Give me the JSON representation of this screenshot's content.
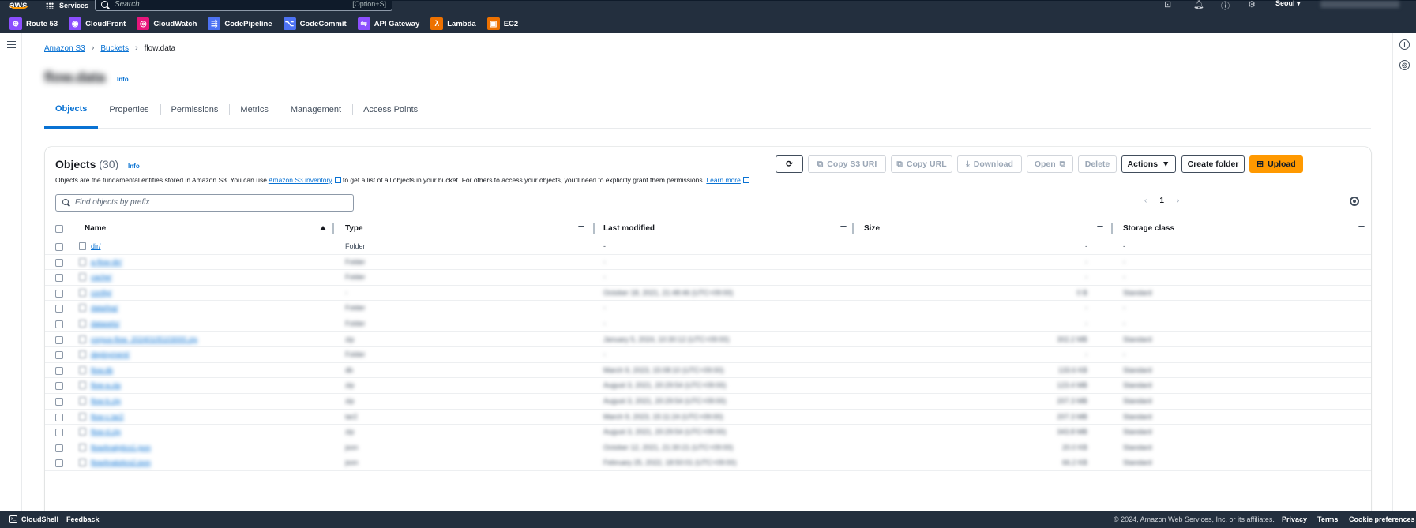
{
  "topnav": {
    "services_label": "Services",
    "search_placeholder": "Search",
    "search_shortcut": "[Option+S]",
    "region": "Seoul",
    "favorites": [
      {
        "label": "Route 53",
        "color": "#8c4fff",
        "icon": "route53-icon"
      },
      {
        "label": "CloudFront",
        "color": "#8c4fff",
        "icon": "cloudfront-icon"
      },
      {
        "label": "CloudWatch",
        "color": "#e7157b",
        "icon": "cloudwatch-icon"
      },
      {
        "label": "CodePipeline",
        "color": "#4d72f3",
        "icon": "codepipeline-icon"
      },
      {
        "label": "CodeCommit",
        "color": "#4d72f3",
        "icon": "codecommit-icon"
      },
      {
        "label": "API Gateway",
        "color": "#8c4fff",
        "icon": "api-gateway-icon"
      },
      {
        "label": "Lambda",
        "color": "#ed7100",
        "icon": "lambda-icon"
      },
      {
        "label": "EC2",
        "color": "#ed7100",
        "icon": "ec2-icon"
      }
    ]
  },
  "breadcrumb": {
    "items": [
      "Amazon S3",
      "Buckets",
      "flow.data"
    ]
  },
  "page": {
    "title": "flow.data",
    "info": "Info"
  },
  "tabs": [
    "Objects",
    "Properties",
    "Permissions",
    "Metrics",
    "Management",
    "Access Points"
  ],
  "objects": {
    "title": "Objects",
    "count": "(30)",
    "info": "Info",
    "desc_prefix": "Objects are the fundamental entities stored in Amazon S3. You can use ",
    "desc_link": "Amazon S3 inventory",
    "desc_middle": " to get a list of all objects in your bucket. For others to access your objects, you'll need to explicitly grant them permissions. ",
    "desc_learn": "Learn more",
    "buttons": {
      "copy_uri": "Copy S3 URI",
      "copy_url": "Copy URL",
      "download": "Download",
      "open": "Open",
      "delete": "Delete",
      "actions": "Actions",
      "create_folder": "Create folder",
      "upload": "Upload"
    },
    "search_placeholder": "Find objects by prefix",
    "page": "1",
    "columns": [
      "Name",
      "Type",
      "Last modified",
      "Size",
      "Storage class"
    ],
    "rows": [
      {
        "name": "dir/",
        "type": "Folder",
        "modified": "-",
        "size": "-",
        "class": "-",
        "blurred": false
      },
      {
        "name": "a-flow-dir/",
        "type": "Folder",
        "modified": "-",
        "size": "-",
        "class": "-",
        "blurred": true
      },
      {
        "name": "cache/",
        "type": "Folder",
        "modified": "-",
        "size": "-",
        "class": "-",
        "blurred": true
      },
      {
        "name": "config/",
        "type": "-",
        "modified": "October 18, 2021, 21:48:46 (UTC+09:00)",
        "size": "0 B",
        "class": "Standard",
        "blurred": true
      },
      {
        "name": "data/log/",
        "type": "Folder",
        "modified": "-",
        "size": "-",
        "class": "-",
        "blurred": true
      },
      {
        "name": "datasets/",
        "type": "Folder",
        "modified": "-",
        "size": "-",
        "class": "-",
        "blurred": true
      },
      {
        "name": "corpus-flow_20240105103000.zip",
        "type": "zip",
        "modified": "January 5, 2024, 10:30:12 (UTC+09:00)",
        "size": "302.2 MB",
        "class": "Standard",
        "blurred": true
      },
      {
        "name": "deployment/",
        "type": "Folder",
        "modified": "-",
        "size": "-",
        "class": "-",
        "blurred": true
      },
      {
        "name": "flow.db",
        "type": "db",
        "modified": "March 9, 2023, 15:08:10 (UTC+09:00)",
        "size": "133.6 KB",
        "class": "Standard",
        "blurred": true
      },
      {
        "name": "flow-a.zip",
        "type": "zip",
        "modified": "August 3, 2021, 20:29:54 (UTC+09:00)",
        "size": "123.4 MB",
        "class": "Standard",
        "blurred": true
      },
      {
        "name": "flow-b.zip",
        "type": "zip",
        "modified": "August 3, 2021, 20:29:54 (UTC+09:00)",
        "size": "207.3 MB",
        "class": "Standard",
        "blurred": true
      },
      {
        "name": "flow-c.tar2",
        "type": "tar2",
        "modified": "March 9, 2023, 15:11:24 (UTC+09:00)",
        "size": "207.3 MB",
        "class": "Standard",
        "blurred": true
      },
      {
        "name": "flow-d.zip",
        "type": "zip",
        "modified": "August 3, 2021, 20:29:54 (UTC+09:00)",
        "size": "343.8 MB",
        "class": "Standard",
        "blurred": true
      },
      {
        "name": "flowAnalytics1.json",
        "type": "json",
        "modified": "October 12, 2021, 21:30:21 (UTC+09:00)",
        "size": "20.0 KB",
        "class": "Standard",
        "blurred": true
      },
      {
        "name": "flowAnalytics2.json",
        "type": "json",
        "modified": "February 25, 2022, 18:50:01 (UTC+09:00)",
        "size": "66.2 KB",
        "class": "Standard",
        "blurred": true
      }
    ]
  },
  "footer": {
    "cloudshell": "CloudShell",
    "feedback": "Feedback",
    "copyright": "© 2024, Amazon Web Services, Inc. or its affiliates.",
    "privacy": "Privacy",
    "terms": "Terms",
    "cookies": "Cookie preferences"
  }
}
